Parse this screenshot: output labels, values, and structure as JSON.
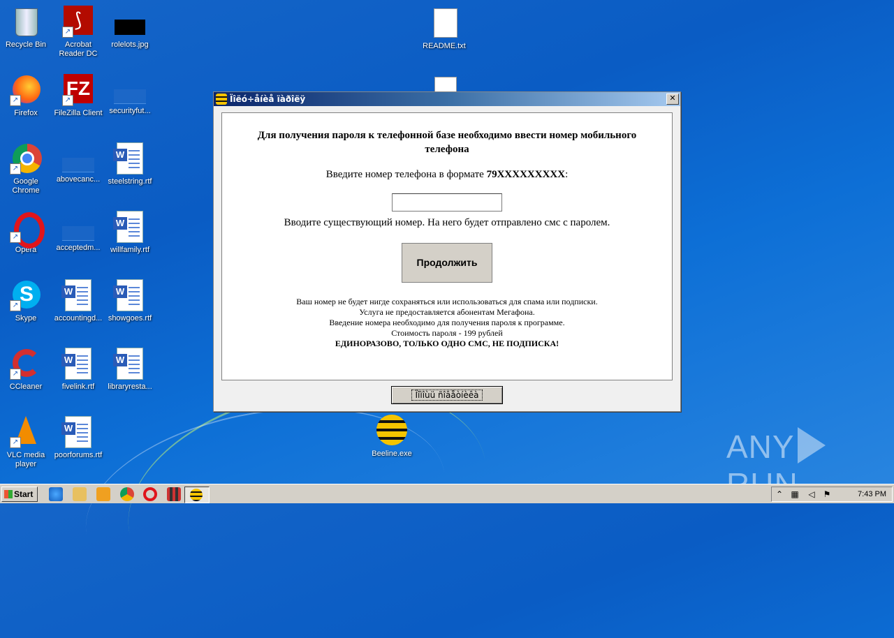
{
  "desktop": {
    "icons": [
      {
        "label": "Recycle Bin"
      },
      {
        "label": "Acrobat Reader DC"
      },
      {
        "label": "rolelots.jpg"
      },
      {
        "label": "README.txt"
      },
      {
        "label": "Firefox"
      },
      {
        "label": "FileZilla Client"
      },
      {
        "label": "securityfut..."
      },
      {
        "label": "Google Chrome"
      },
      {
        "label": "abovecanc..."
      },
      {
        "label": "steelstring.rtf"
      },
      {
        "label": "Opera"
      },
      {
        "label": "acceptedm..."
      },
      {
        "label": "willfamily.rtf"
      },
      {
        "label": "Skype"
      },
      {
        "label": "accountingd..."
      },
      {
        "label": "showgoes.rtf"
      },
      {
        "label": "CCleaner"
      },
      {
        "label": "fivelink.rtf"
      },
      {
        "label": "libraryresta..."
      },
      {
        "label": "VLC media player"
      },
      {
        "label": "poorforums.rtf"
      },
      {
        "label": "Beeline.exe"
      }
    ]
  },
  "dialog": {
    "title": "Ïîëó÷åíèå ïàðîëÿ",
    "close_glyph": "✕",
    "heading": "Для получения пароля к телефонной базе необходимо ввести номер мобильного телефона",
    "prompt_prefix": "Введите номер телефона в формате ",
    "prompt_format": "79XXXXXXXXX",
    "prompt_suffix": ":",
    "phone_value": "",
    "hint": "Вводите существующий номер. На него будет отправлено смс с паролем.",
    "continue_label": "Продолжить",
    "notes": [
      "Ваш номер не будет нигде сохраняться или использоваться для спама или подписки.",
      "Услуга не предоставляется абонентам Мегафона.",
      "Введение номера необходимо для получения пароля к программе.",
      "Стоимость пароля - 199 рублей"
    ],
    "notes_bold": "ЕДИНОРАЗОВО, ТОЛЬКО ОДНО СМС, НЕ ПОДПИСКА!",
    "bottom_button": "Ïîìîùü ñîâåòíèêà"
  },
  "taskbar": {
    "start_label": "Start",
    "clock": "7:43 PM"
  },
  "watermark": {
    "left": "ANY",
    "right": "RUN"
  }
}
